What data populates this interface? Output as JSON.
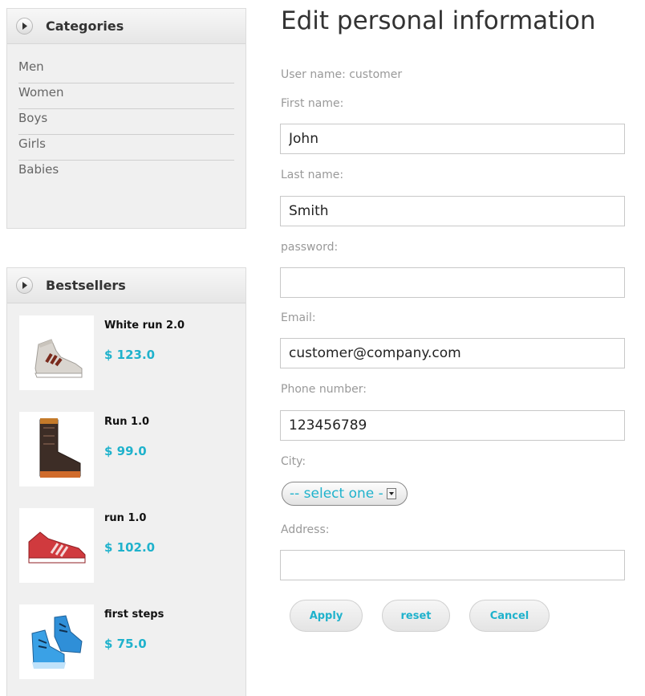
{
  "categories": {
    "title": "Categories",
    "items": [
      "Men",
      "Women",
      "Boys",
      "Girls",
      "Babies"
    ]
  },
  "bestsellers": {
    "title": "Bestsellers",
    "items": [
      {
        "name": "White run 2.0",
        "price": "$ 123.0",
        "icon": "white-high-top-shoe-icon"
      },
      {
        "name": "Run 1.0",
        "price": "$ 99.0",
        "icon": "brown-boot-icon"
      },
      {
        "name": "run 1.0",
        "price": "$ 102.0",
        "icon": "red-sneaker-icon"
      },
      {
        "name": "first steps",
        "price": "$ 75.0",
        "icon": "blue-baby-shoes-icon"
      }
    ]
  },
  "form": {
    "title": "Edit personal information",
    "username_text": "User name: customer",
    "first_name": {
      "label": "First name:",
      "value": "John"
    },
    "last_name": {
      "label": "Last name:",
      "value": "Smith"
    },
    "password": {
      "label": "password:",
      "value": ""
    },
    "email": {
      "label": "Email:",
      "value": "customer@company.com"
    },
    "phone": {
      "label": "Phone number:",
      "value": "123456789"
    },
    "city": {
      "label": "City:",
      "selected": "-- select one -"
    },
    "address": {
      "label": "Address:",
      "value": ""
    },
    "buttons": {
      "apply": "Apply",
      "reset": "reset",
      "cancel": "Cancel"
    }
  },
  "colors": {
    "accent": "#1fb2cc",
    "panel": "#f0f0f0",
    "label": "#999999"
  }
}
